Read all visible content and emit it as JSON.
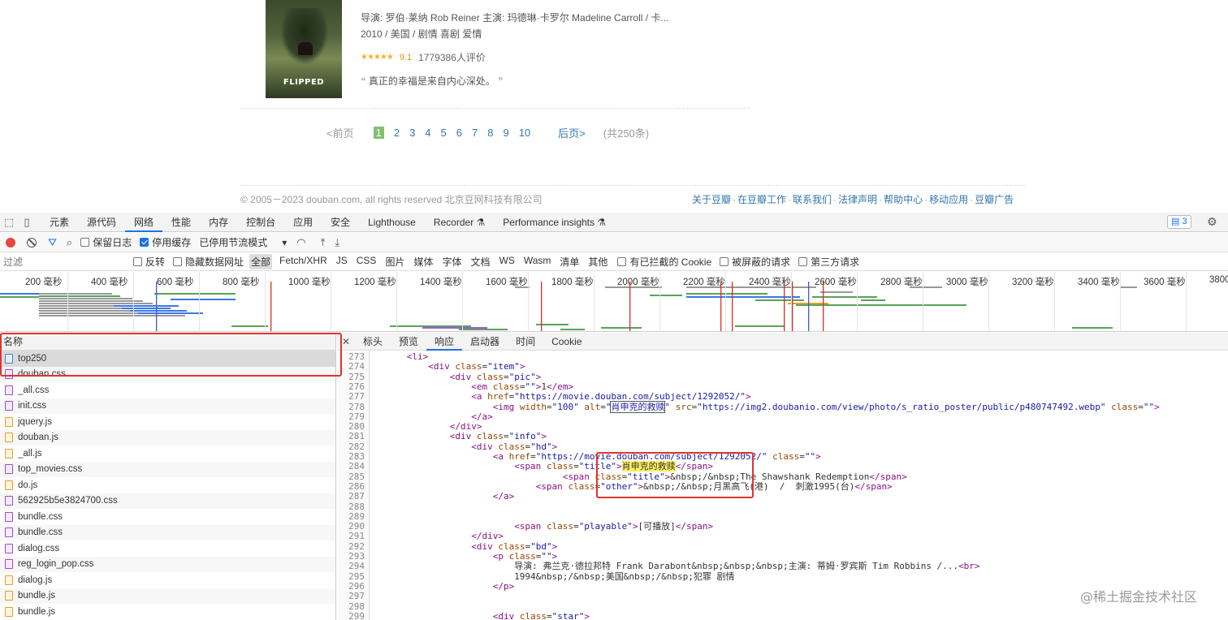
{
  "movie": {
    "poster_title": "FLIPPED",
    "director_line": "导演: 罗伯·莱纳 Rob Reiner   主演: 玛德琳·卡罗尔 Madeline Carroll / 卡...",
    "meta_line": "2010 / 美国 / 剧情 喜剧 爱情",
    "stars": "★★★★★",
    "score": "9.1",
    "votes": "1779386人评价",
    "quote_open": "❝",
    "quote": "真正的幸福是来自内心深处。",
    "quote_close": "❞"
  },
  "pager": {
    "prev": "<前页",
    "pages": [
      "1",
      "2",
      "3",
      "4",
      "5",
      "6",
      "7",
      "8",
      "9",
      "10"
    ],
    "next": "后页>",
    "total": "(共250条)"
  },
  "footer": {
    "copyright": "© 2005－2023 douban.com, all rights reserved 北京豆网科技有限公司",
    "links": [
      "关于豆瓣",
      "在豆瓣工作",
      "联系我们",
      "法律声明",
      "帮助中心",
      "移动应用",
      "豆瓣广告"
    ]
  },
  "devtools": {
    "tabs": [
      "元素",
      "源代码",
      "网络",
      "性能",
      "内存",
      "控制台",
      "应用",
      "安全",
      "Lighthouse",
      "Recorder ⚗",
      "Performance insights ⚗"
    ],
    "issues_count": "3",
    "toolbar": {
      "preserve_log": "保留日志",
      "disable_cache": "停用缓存",
      "throttling": "已停用节流模式"
    },
    "filter": {
      "placeholder": "过滤",
      "invert": "反转",
      "hide_data_urls": "隐藏数据网址",
      "types": [
        "全部",
        "Fetch/XHR",
        "JS",
        "CSS",
        "图片",
        "媒体",
        "字体",
        "文档",
        "WS",
        "Wasm",
        "清单",
        "其他"
      ],
      "blocked_cookies": "有已拦截的 Cookie",
      "blocked_requests": "被屏蔽的请求",
      "third_party": "第三方请求"
    },
    "timeline_labels": [
      "200 毫秒",
      "400 毫秒",
      "600 毫秒",
      "800 毫秒",
      "1000 毫秒",
      "1200 毫秒",
      "1400 毫秒",
      "1600 毫秒",
      "1800 毫秒",
      "2000 毫秒",
      "2200 毫秒",
      "2400 毫秒",
      "2600 毫秒",
      "2800 毫秒",
      "3000 毫秒",
      "3200 毫秒",
      "3400 毫秒",
      "3600 毫秒",
      "3800"
    ],
    "names_header": "名称",
    "requests": [
      {
        "name": "top250",
        "type": "doc"
      },
      {
        "name": "douban.css",
        "type": "css"
      },
      {
        "name": "_all.css",
        "type": "css"
      },
      {
        "name": "init.css",
        "type": "css"
      },
      {
        "name": "jquery.js",
        "type": "js"
      },
      {
        "name": "douban.js",
        "type": "js"
      },
      {
        "name": "_all.js",
        "type": "js"
      },
      {
        "name": "top_movies.css",
        "type": "css"
      },
      {
        "name": "do.js",
        "type": "js"
      },
      {
        "name": "562925b5e3824700.css",
        "type": "css"
      },
      {
        "name": "bundle.css",
        "type": "css"
      },
      {
        "name": "bundle.css",
        "type": "css"
      },
      {
        "name": "dialog.css",
        "type": "css"
      },
      {
        "name": "reg_login_pop.css",
        "type": "css"
      },
      {
        "name": "dialog.js",
        "type": "js"
      },
      {
        "name": "bundle.js",
        "type": "js"
      },
      {
        "name": "bundle.js",
        "type": "js"
      }
    ],
    "panel_tabs": [
      "标头",
      "预览",
      "响应",
      "启动器",
      "时间",
      "Cookie"
    ],
    "code_lines": [
      {
        "n": "273",
        "indent": 6,
        "html": "<span class='tag'>&lt;li&gt;</span>"
      },
      {
        "n": "274",
        "indent": 10,
        "html": "<span class='tag'>&lt;div</span> <span class='attr'>class</span>=<span class='val'>\"item\"</span><span class='tag'>&gt;</span>"
      },
      {
        "n": "275",
        "indent": 14,
        "html": "<span class='tag'>&lt;div</span> <span class='attr'>class</span>=<span class='val'>\"pic\"</span><span class='tag'>&gt;</span>"
      },
      {
        "n": "276",
        "indent": 18,
        "html": "<span class='tag'>&lt;em</span> <span class='attr'>class</span>=<span class='val'>\"\"</span><span class='tag'>&gt;</span>1<span class='tag'>&lt;/em&gt;</span>"
      },
      {
        "n": "277",
        "indent": 18,
        "html": "<span class='tag'>&lt;a</span> <span class='attr'>href</span>=<span class='val'>\"https://movie.douban.com/subject/1292052/\"</span><span class='tag'>&gt;</span>"
      },
      {
        "n": "278",
        "indent": 22,
        "html": "<span class='tag'>&lt;img</span> <span class='attr'>width</span>=<span class='val'>\"100\"</span> <span class='attr'>alt</span>=<span class='val'>\"<span class='boxhl'>肖申克的救赎</span>\"</span> <span class='attr'>src</span>=<span class='val'>\"https://img2.doubanio.com/view/photo/s_ratio_poster/public/p480747492.webp\"</span> <span class='attr'>class</span>=<span class='val'>\"\"</span><span class='tag'>&gt;</span>"
      },
      {
        "n": "279",
        "indent": 18,
        "html": "<span class='tag'>&lt;/a&gt;</span>"
      },
      {
        "n": "280",
        "indent": 14,
        "html": "<span class='tag'>&lt;/div&gt;</span>"
      },
      {
        "n": "281",
        "indent": 14,
        "html": "<span class='tag'>&lt;div</span> <span class='attr'>class</span>=<span class='val'>\"info\"</span><span class='tag'>&gt;</span>"
      },
      {
        "n": "282",
        "indent": 18,
        "html": "<span class='tag'>&lt;div</span> <span class='attr'>class</span>=<span class='val'>\"hd\"</span><span class='tag'>&gt;</span>"
      },
      {
        "n": "283",
        "indent": 22,
        "html": "<span class='tag'>&lt;a</span> <span class='attr'>href</span>=<span class='val'>\"https://movie.douban.com/subject/1292052/\"</span> <span class='attr'>class</span>=<span class='val'>\"\"</span><span class='tag'>&gt;</span>"
      },
      {
        "n": "284",
        "indent": 26,
        "html": "<span class='tag'>&lt;span</span> <span class='attr'>class</span>=<span class='val'>\"title\"</span><span class='tag'>&gt;</span><span class='hl'>肖申克的救赎</span><span class='tag'>&lt;/span&gt;</span>"
      },
      {
        "n": "285",
        "indent": 35,
        "html": "<span class='tag'>&lt;span</span> <span class='attr'>class</span>=<span class='val'>\"title\"</span><span class='tag'>&gt;</span>&amp;nbsp;/&amp;nbsp;The Shawshank Redemption<span class='tag'>&lt;/span&gt;</span>"
      },
      {
        "n": "286",
        "indent": 30,
        "html": "<span class='tag'>&lt;span</span> <span class='attr'>class</span>=<span class='val'>\"other\"</span><span class='tag'>&gt;</span>&amp;nbsp;/&amp;nbsp;月黑高飞(港)  /  刺激1995(台)<span class='tag'>&lt;/span&gt;</span>"
      },
      {
        "n": "287",
        "indent": 22,
        "html": "<span class='tag'>&lt;/a&gt;</span>"
      },
      {
        "n": "288",
        "indent": 0,
        "html": ""
      },
      {
        "n": "289",
        "indent": 0,
        "html": ""
      },
      {
        "n": "290",
        "indent": 26,
        "html": "<span class='tag'>&lt;span</span> <span class='attr'>class</span>=<span class='val'>\"playable\"</span><span class='tag'>&gt;</span>[可播放]<span class='tag'>&lt;/span&gt;</span>"
      },
      {
        "n": "291",
        "indent": 18,
        "html": "<span class='tag'>&lt;/div&gt;</span>"
      },
      {
        "n": "292",
        "indent": 18,
        "html": "<span class='tag'>&lt;div</span> <span class='attr'>class</span>=<span class='val'>\"bd\"</span><span class='tag'>&gt;</span>"
      },
      {
        "n": "293",
        "indent": 22,
        "html": "<span class='tag'>&lt;p</span> <span class='attr'>class</span>=<span class='val'>\"\"</span><span class='tag'>&gt;</span>"
      },
      {
        "n": "294",
        "indent": 26,
        "html": "导演: 弗兰克·德拉邦特 Frank Darabont&amp;nbsp;&amp;nbsp;&amp;nbsp;主演: 蒂姆·罗宾斯 Tim Robbins /...<span class='tag'>&lt;br&gt;</span>"
      },
      {
        "n": "295",
        "indent": 26,
        "html": "1994&amp;nbsp;/&amp;nbsp;美国&amp;nbsp;/&amp;nbsp;犯罪 剧情"
      },
      {
        "n": "296",
        "indent": 22,
        "html": "<span class='tag'>&lt;/p&gt;</span>"
      },
      {
        "n": "297",
        "indent": 0,
        "html": ""
      },
      {
        "n": "298",
        "indent": 0,
        "html": ""
      },
      {
        "n": "299",
        "indent": 22,
        "html": "<span class='tag'>&lt;div</span> <span class='attr'>class</span>=<span class='val'>\"star\"</span><span class='tag'>&gt;</span>"
      }
    ]
  },
  "watermark": "@稀土掘金技术社区"
}
